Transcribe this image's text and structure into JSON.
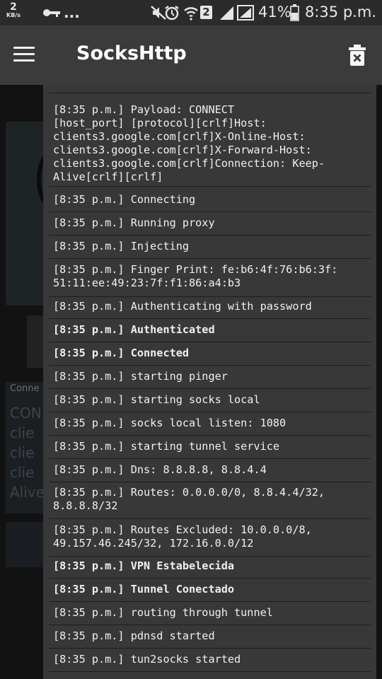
{
  "status_bar": {
    "net_speed": "2",
    "net_speed_unit": "KB/s",
    "overflow": "...",
    "sim_badge": "2",
    "battery_percent": "41%",
    "time": "8:35 p.m."
  },
  "toolbar": {
    "title": "SocksHttp"
  },
  "background": {
    "card_label": "Conne",
    "card_text": "CON\nclie\nclie\nclie\nAlive"
  },
  "log": {
    "entries": [
      "[8:35 p.m.] Payload: CONNECT\n[host_port] [protocol][crlf]Host:\nclients3.google.com[crlf]X-Online-Host:\nclients3.google.com[crlf]X-Forward-Host:\nclients3.google.com[crlf]Connection: Keep-\nAlive[crlf][crlf]",
      "[8:35 p.m.] Connecting",
      "[8:35 p.m.] Running proxy",
      "[8:35 p.m.] Injecting",
      "[8:35 p.m.] Finger Print: fe:b6:4f:76:b6:3f:\n51:11:ee:49:23:7f:f1:86:a4:b3",
      "[8:35 p.m.] Authenticating with password",
      "[8:35 p.m.] Authenticated",
      "[8:35 p.m.] Connected",
      "[8:35 p.m.] starting pinger",
      "[8:35 p.m.] starting socks local",
      "[8:35 p.m.] socks local listen: 1080",
      "[8:35 p.m.] starting tunnel service",
      "[8:35 p.m.] Dns: 8.8.8.8, 8.8.4.4",
      "[8:35 p.m.] Routes: 0.0.0.0/0, 8.8.4.4/32,\n8.8.8.8/32",
      "[8:35 p.m.] Routes Excluded: 10.0.0.0/8,\n49.157.46.245/32, 172.16.0.0/12",
      "[8:35 p.m.] VPN Estabelecida",
      "[8:35 p.m.] Tunnel Conectado",
      "[8:35 p.m.] routing through tunnel",
      "[8:35 p.m.] pdnsd started",
      "[8:35 p.m.] tun2socks started"
    ]
  }
}
